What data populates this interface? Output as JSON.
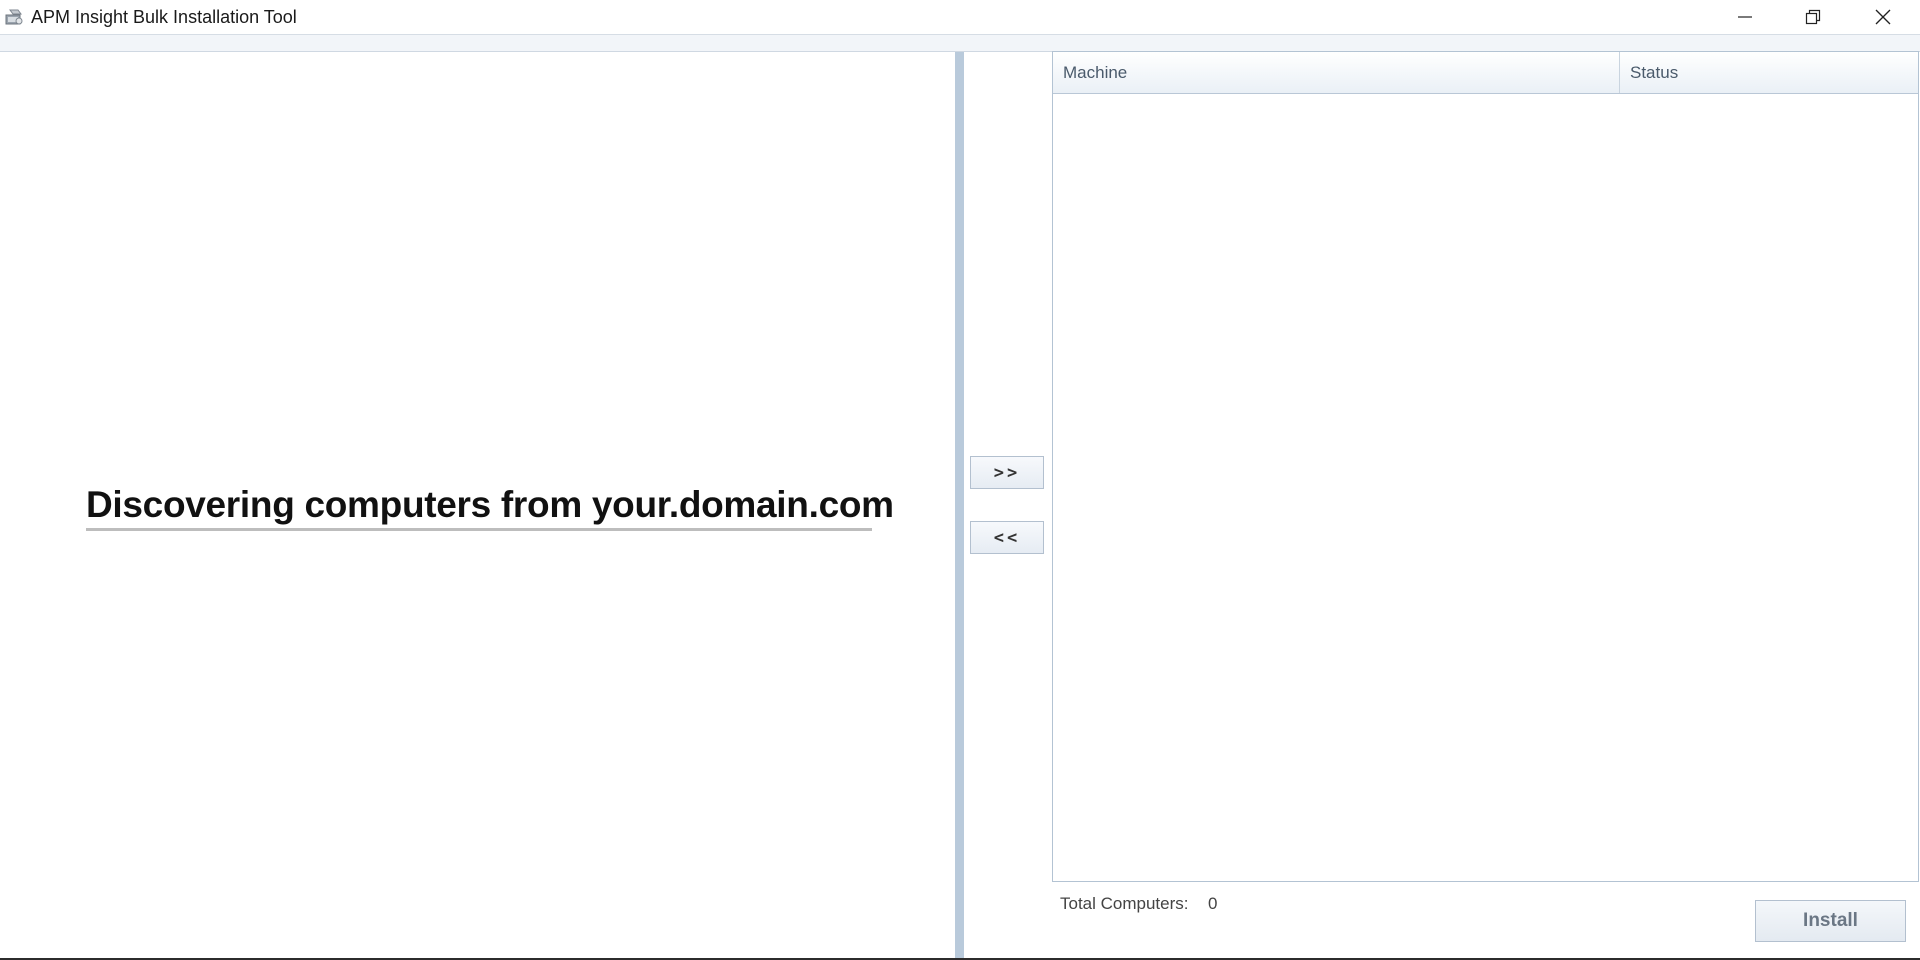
{
  "window": {
    "title": "APM Insight Bulk Installation Tool",
    "app_icon": "installer-icon",
    "controls": {
      "minimize_icon": "minimize-icon",
      "restore_icon": "restore-icon",
      "close_icon": "close-icon"
    }
  },
  "left_pane": {
    "status_message": "Discovering computers from your.domain.com"
  },
  "transfer": {
    "add_label": ">>",
    "remove_label": "<<"
  },
  "machine_list": {
    "columns": [
      "Machine",
      "Status"
    ],
    "rows": []
  },
  "footer": {
    "total_label": "Total Computers:",
    "total_value": "0",
    "install_label": "Install"
  },
  "colors": {
    "splitter": "#b9cadb",
    "header_text": "#4a5a6b",
    "button_border": "#b3c0cf"
  }
}
